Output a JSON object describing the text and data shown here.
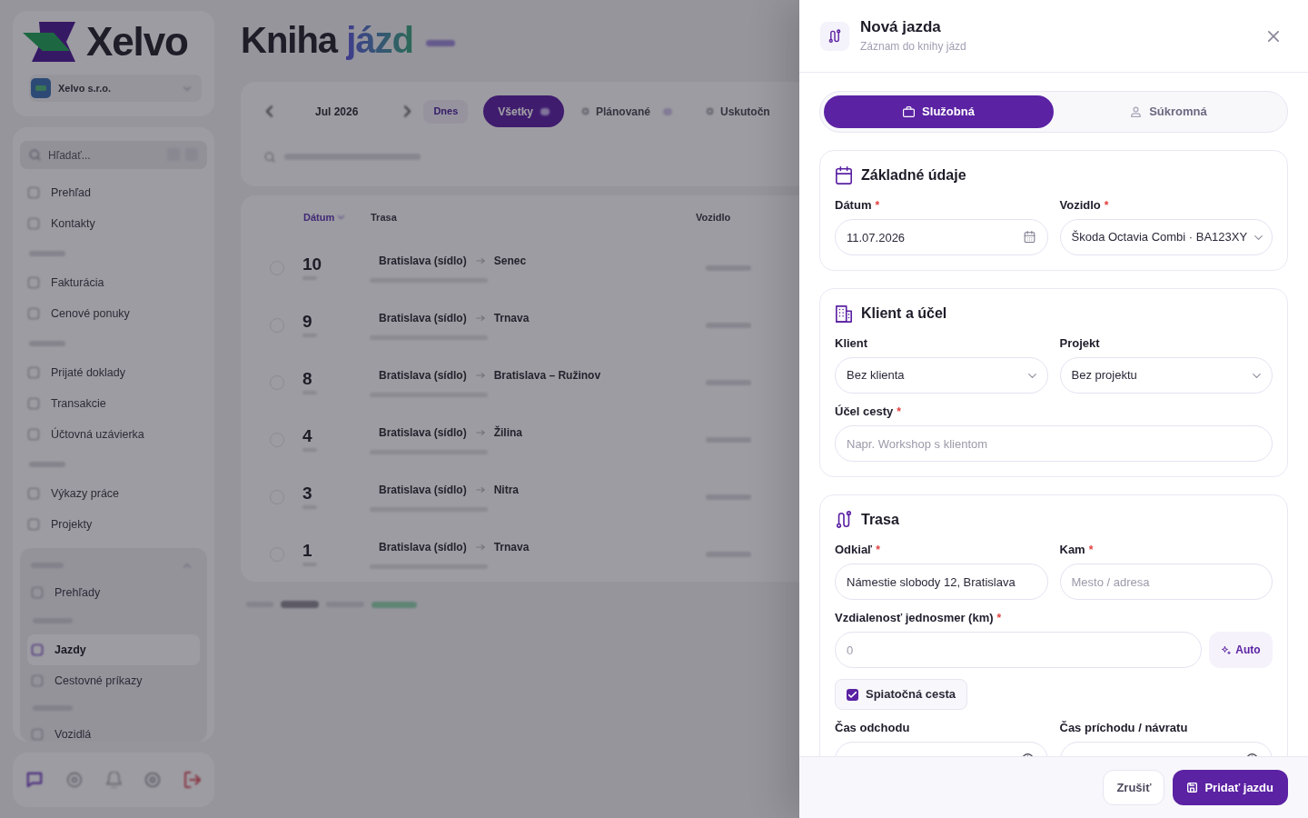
{
  "sidebar": {
    "logo": "Xelvo",
    "workspace": "Xelvo s.r.o.",
    "search": {
      "placeholder": "Hľadať..."
    },
    "nav_groups": [
      {
        "items": [
          "Prehľad",
          "Kontakty"
        ]
      },
      {
        "items": [
          "Fakturácia",
          "Cenové ponuky"
        ]
      },
      {
        "items": [
          "Prijaté doklady",
          "Transakcie",
          "Účtovná uzávierka"
        ]
      },
      {
        "items": [
          "Výkazy práce",
          "Projekty"
        ]
      }
    ],
    "panel": {
      "items": [
        {
          "label": "Prehľady",
          "selected": false
        },
        {
          "label": "Jazdy",
          "selected": true
        },
        {
          "label": "Cestovné príkazy",
          "selected": false
        },
        {
          "label": "Vozidlá",
          "selected": false
        }
      ]
    }
  },
  "page": {
    "title": "Kniha",
    "title_accent": "jázd",
    "period": "Jul 2026",
    "today": "Dnes",
    "filters": [
      {
        "label": "Všetky",
        "selected": true
      },
      {
        "label": "Plánované",
        "selected": false
      },
      {
        "label": "Uskutočn",
        "selected": false
      }
    ],
    "table": {
      "columns": [
        "Dátum",
        "Trasa",
        "Vozidlo"
      ],
      "rows": [
        {
          "checked": false,
          "day": "10",
          "from": "Bratislava (sídlo)",
          "to": "Senec"
        },
        {
          "checked": false,
          "day": "9",
          "from": "Bratislava (sídlo)",
          "to": "Trnava"
        },
        {
          "checked": false,
          "day": "8",
          "from": "Bratislava (sídlo)",
          "to": "Bratislava – Ružinov"
        },
        {
          "checked": false,
          "day": "4",
          "from": "Bratislava (sídlo)",
          "to": "Žilina"
        },
        {
          "checked": false,
          "day": "3",
          "from": "Bratislava (sídlo)",
          "to": "Nitra"
        },
        {
          "checked": false,
          "day": "1",
          "from": "Bratislava (sídlo)",
          "to": "Trnava"
        }
      ]
    }
  },
  "drawer": {
    "title": "Nová jazda",
    "subtitle": "Záznam do knihy jázd",
    "trip_types": [
      {
        "label": "Služobná",
        "selected": true
      },
      {
        "label": "Súkromná",
        "selected": false
      }
    ],
    "sections": [
      {
        "title": "Základné údaje",
        "rows": [
          [
            {
              "kind": "date",
              "label": "Dátum",
              "required_mark": "*",
              "value": "11.07.2026"
            },
            {
              "kind": "select",
              "label": "Vozidlo",
              "required_mark": "*",
              "value": "Škoda Octavia Combi · BA123XY"
            }
          ]
        ]
      },
      {
        "title": "Klient a účel",
        "rows": [
          [
            {
              "kind": "select",
              "label": "Klient",
              "value": "Bez klienta"
            },
            {
              "kind": "select",
              "label": "Projekt",
              "value": "Bez projektu"
            }
          ],
          [
            {
              "kind": "text",
              "label": "Účel cesty",
              "required_mark": "*",
              "placeholder": "Napr. Workshop s klientom"
            }
          ]
        ]
      },
      {
        "title": "Trasa",
        "rows": [
          [
            {
              "kind": "text",
              "label": "Odkiaľ",
              "required_mark": "*",
              "value": "Námestie slobody 12, Bratislava"
            },
            {
              "kind": "text",
              "label": "Kam",
              "required_mark": "*",
              "placeholder": "Mesto / adresa"
            }
          ],
          [
            {
              "kind": "distance",
              "label": "Vzdialenosť jednosmer (km)",
              "required_mark": "*",
              "placeholder": "0",
              "button": "Auto"
            }
          ],
          [
            {
              "kind": "checkbox",
              "label": "Spiatočná cesta",
              "checked": true
            }
          ],
          [
            {
              "kind": "time",
              "label": "Čas odchodu"
            },
            {
              "kind": "time",
              "label": "Čas príchodu / návratu"
            }
          ]
        ]
      }
    ],
    "buttons": [
      {
        "label": "Zrušiť",
        "kind": "secondary"
      },
      {
        "label": "Pridať jazdu",
        "kind": "primary"
      }
    ]
  }
}
